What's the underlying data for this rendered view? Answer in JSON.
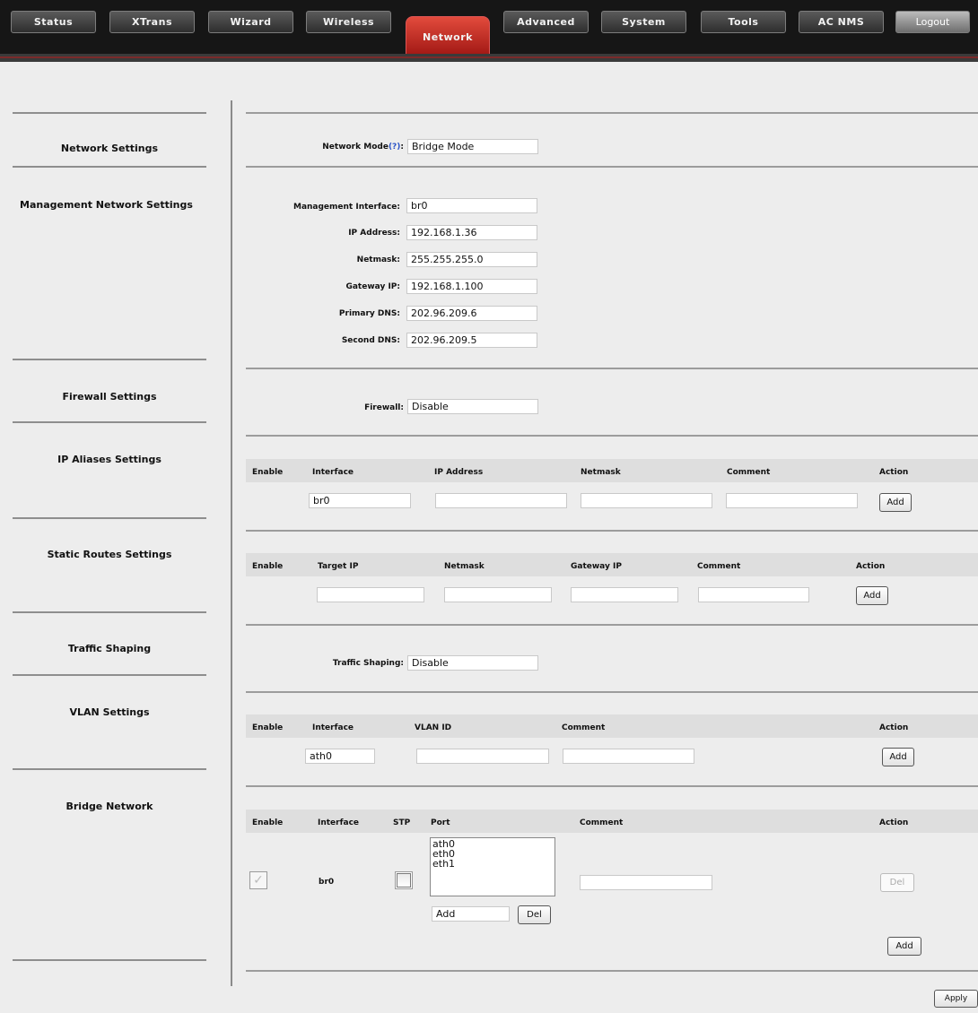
{
  "nav": {
    "tabs": [
      "Status",
      "XTrans",
      "Wizard",
      "Wireless",
      "Network",
      "Advanced",
      "System",
      "Tools",
      "AC NMS"
    ],
    "active": "Network",
    "logout": "Logout"
  },
  "side_menu": {
    "items": [
      "Network Settings",
      "Management Network Settings",
      "Firewall Settings",
      "IP Aliases Settings",
      "Static Routes Settings",
      "Traffic Shaping",
      "VLAN Settings",
      "Bridge Network"
    ]
  },
  "network_settings": {
    "mode_label": "Network Mode",
    "mode_help": "(?)",
    "mode_suffix": ":",
    "mode_value": "Bridge Mode"
  },
  "management": {
    "fields": [
      {
        "label": "Management Interface:",
        "value": "br0"
      },
      {
        "label": "IP Address:",
        "value": "192.168.1.36"
      },
      {
        "label": "Netmask:",
        "value": "255.255.255.0"
      },
      {
        "label": "Gateway IP:",
        "value": "192.168.1.100"
      },
      {
        "label": "Primary DNS:",
        "value": "202.96.209.6"
      },
      {
        "label": "Second DNS:",
        "value": "202.96.209.5"
      }
    ]
  },
  "firewall": {
    "label": "Firewall:",
    "value": "Disable"
  },
  "ip_aliases": {
    "headers": [
      "Enable",
      "Interface",
      "IP Address",
      "Netmask",
      "Comment",
      "Action"
    ],
    "interface_value": "br0",
    "add_label": "Add"
  },
  "static_routes": {
    "headers": [
      "Enable",
      "Target IP",
      "Netmask",
      "Gateway IP",
      "Comment",
      "Action"
    ],
    "add_label": "Add"
  },
  "traffic_shaping": {
    "label": "Traffic Shaping:",
    "value": "Disable"
  },
  "vlan": {
    "headers": [
      "Enable",
      "Interface",
      "VLAN ID",
      "Comment",
      "Action"
    ],
    "interface_value": "ath0",
    "add_label": "Add"
  },
  "bridge": {
    "headers": [
      "Enable",
      "Interface",
      "STP",
      "Port",
      "Comment",
      "Action"
    ],
    "interface": "br0",
    "ports": [
      "ath0",
      "eth0",
      "eth1"
    ],
    "port_input_value": "Add",
    "port_del_label": "Del",
    "del_label": "Del",
    "add_label": "Add",
    "enable_checkmark": "✓"
  },
  "apply_label": "Apply"
}
